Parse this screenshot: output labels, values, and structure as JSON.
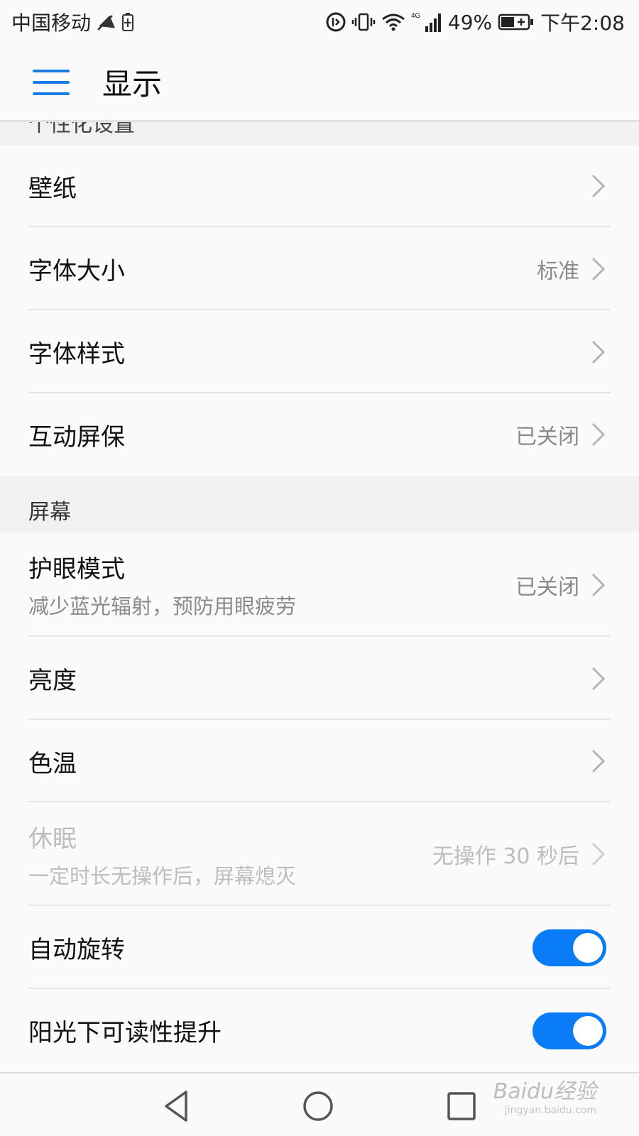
{
  "status_bar": {
    "carrier": "中国移动",
    "network": "4G",
    "battery_percent": "49%",
    "time": "下午2:08"
  },
  "header": {
    "title": "显示"
  },
  "sections": {
    "personalization_title": "个性化设置",
    "screen_title": "屏幕"
  },
  "rows": {
    "wallpaper": {
      "title": "壁纸"
    },
    "font_size": {
      "title": "字体大小",
      "value": "标准"
    },
    "font_style": {
      "title": "字体样式"
    },
    "screensaver": {
      "title": "互动屏保",
      "value": "已关闭"
    },
    "eye_comfort": {
      "title": "护眼模式",
      "subtitle": "减少蓝光辐射，预防用眼疲劳",
      "value": "已关闭"
    },
    "brightness": {
      "title": "亮度"
    },
    "color_temp": {
      "title": "色温"
    },
    "sleep": {
      "title": "休眠",
      "subtitle": "一定时长无操作后，屏幕熄灭",
      "value": "无操作 30 秒后"
    },
    "auto_rotate": {
      "title": "自动旋转",
      "on": true
    },
    "sunlight": {
      "title": "阳光下可读性提升",
      "on": true
    }
  },
  "watermark": {
    "brand": "Baidu经验",
    "url": "jingyan.baidu.com"
  },
  "colors": {
    "accent": "#1a7ee6",
    "toggle_on": "#0a7cf7",
    "secondary_text": "#8a8a8a"
  }
}
